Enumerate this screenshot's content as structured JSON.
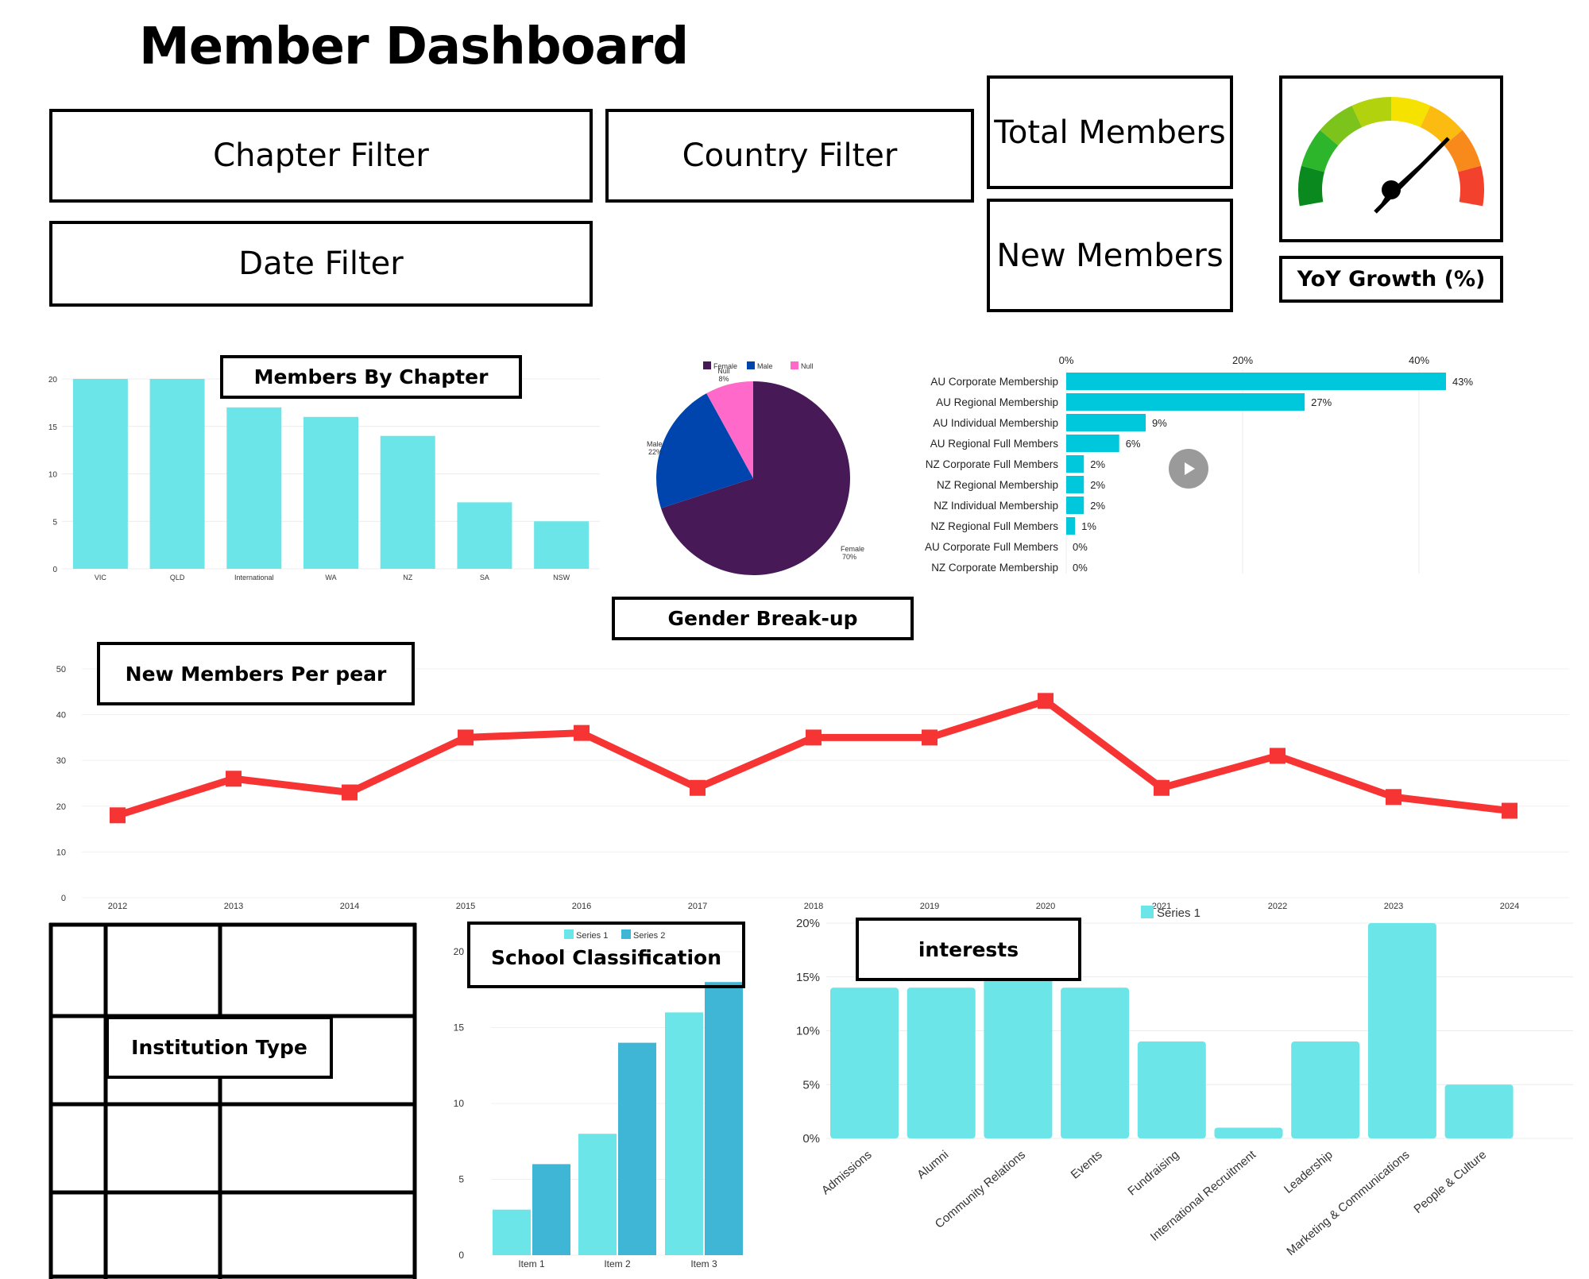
{
  "page": {
    "title": "Member Dashboard"
  },
  "filters": {
    "chapter": "Chapter Filter",
    "country": "Country Filter",
    "date": "Date Filter"
  },
  "kpis": {
    "total_members": "Total Members",
    "new_members": "New Members",
    "yoy_growth": "YoY Growth (%)"
  },
  "gauge": {
    "colors": [
      "#0a8a1e",
      "#2db52c",
      "#7cc31b",
      "#b3d20e",
      "#f6e200",
      "#fbbb10",
      "#f88a1c",
      "#f2412d"
    ]
  },
  "colors": {
    "cyan_bar": "#6ce5e8",
    "teal_bar": "#00c8dc",
    "series2": "#40b6d6",
    "line": "#f73434",
    "female": "#471a57",
    "male": "#0045ad",
    "null": "#ff69c9"
  },
  "charts": {
    "members_by_chapter": {
      "title": "Members By Chapter"
    },
    "gender": {
      "title": "Gender Break-up"
    },
    "new_members_per_year": {
      "title": "New Members Per pear"
    },
    "institution_type": {
      "title": "Institution Type"
    },
    "school_classification": {
      "title": "School Classification"
    },
    "interests": {
      "title": "interests"
    }
  },
  "chart_data": [
    {
      "type": "bar",
      "title": "Members By Chapter",
      "categories": [
        "VIC",
        "QLD",
        "International",
        "WA",
        "NZ",
        "SA",
        "NSW"
      ],
      "values": [
        20,
        20,
        17,
        16,
        14,
        7,
        5
      ],
      "ylim": [
        0,
        20
      ],
      "yticks": [
        0,
        5,
        10,
        15,
        20
      ],
      "grid": true
    },
    {
      "type": "pie",
      "title": "Gender Break-up",
      "legend": [
        "Female",
        "Male",
        "Null"
      ],
      "legend_position": "top",
      "slices": [
        {
          "name": "Female",
          "value": 70,
          "label": "70%"
        },
        {
          "name": "Male",
          "value": 22,
          "label": "22%"
        },
        {
          "name": "Null",
          "value": 8,
          "label": "8%"
        }
      ]
    },
    {
      "type": "bar",
      "orientation": "horizontal",
      "categories": [
        "AU Corporate Membership",
        "AU Regional Membership",
        "AU Individual Membership",
        "AU Regional Full Members",
        "NZ Corporate Full Members",
        "NZ Regional Membership",
        "NZ Individual Membership",
        "NZ Regional Full Members",
        "AU Corporate Full Members",
        "NZ Corporate Membership"
      ],
      "values": [
        43,
        27,
        9,
        6,
        2,
        2,
        2,
        1,
        0,
        0
      ],
      "data_labels": [
        "43%",
        "27%",
        "9%",
        "6%",
        "2%",
        "2%",
        "2%",
        "1%",
        "0%",
        "0%"
      ],
      "xticks": [
        "0%",
        "20%",
        "40%"
      ],
      "xlim": [
        0,
        45
      ]
    },
    {
      "type": "line",
      "title": "New Members Per pear",
      "x": [
        "2012",
        "2013",
        "2014",
        "2015",
        "2016",
        "2017",
        "2018",
        "2019",
        "2020",
        "2021",
        "2022",
        "2023",
        "2024"
      ],
      "values": [
        18,
        26,
        23,
        35,
        36,
        24,
        35,
        35,
        43,
        24,
        31,
        22,
        19
      ],
      "ylim": [
        0,
        50
      ],
      "yticks": [
        0,
        10,
        20,
        30,
        40,
        50
      ],
      "grid": true
    },
    {
      "type": "bar",
      "title": "School Classification",
      "categories": [
        "Item 1",
        "Item 2",
        "Item 3"
      ],
      "series": [
        {
          "name": "Series 1",
          "values": [
            3,
            8,
            16
          ]
        },
        {
          "name": "Series 2",
          "values": [
            6,
            14,
            18
          ]
        }
      ],
      "ylim": [
        0,
        20
      ],
      "yticks": [
        0,
        5,
        10,
        15,
        20
      ],
      "legend_position": "top"
    },
    {
      "type": "bar",
      "title": "interests",
      "categories": [
        "Admissions",
        "Alumni",
        "Community Relations",
        "Events",
        "Fundraising",
        "International Recruitment",
        "Leadership",
        "Marketing & Communications",
        "People & Culture"
      ],
      "series": [
        {
          "name": "Series 1",
          "values": [
            14,
            14,
            15,
            14,
            9,
            1,
            9,
            20,
            5
          ]
        }
      ],
      "ylim": [
        0,
        20
      ],
      "yticks": [
        "0%",
        "5%",
        "10%",
        "15%",
        "20%"
      ],
      "legend_position": "top"
    }
  ]
}
